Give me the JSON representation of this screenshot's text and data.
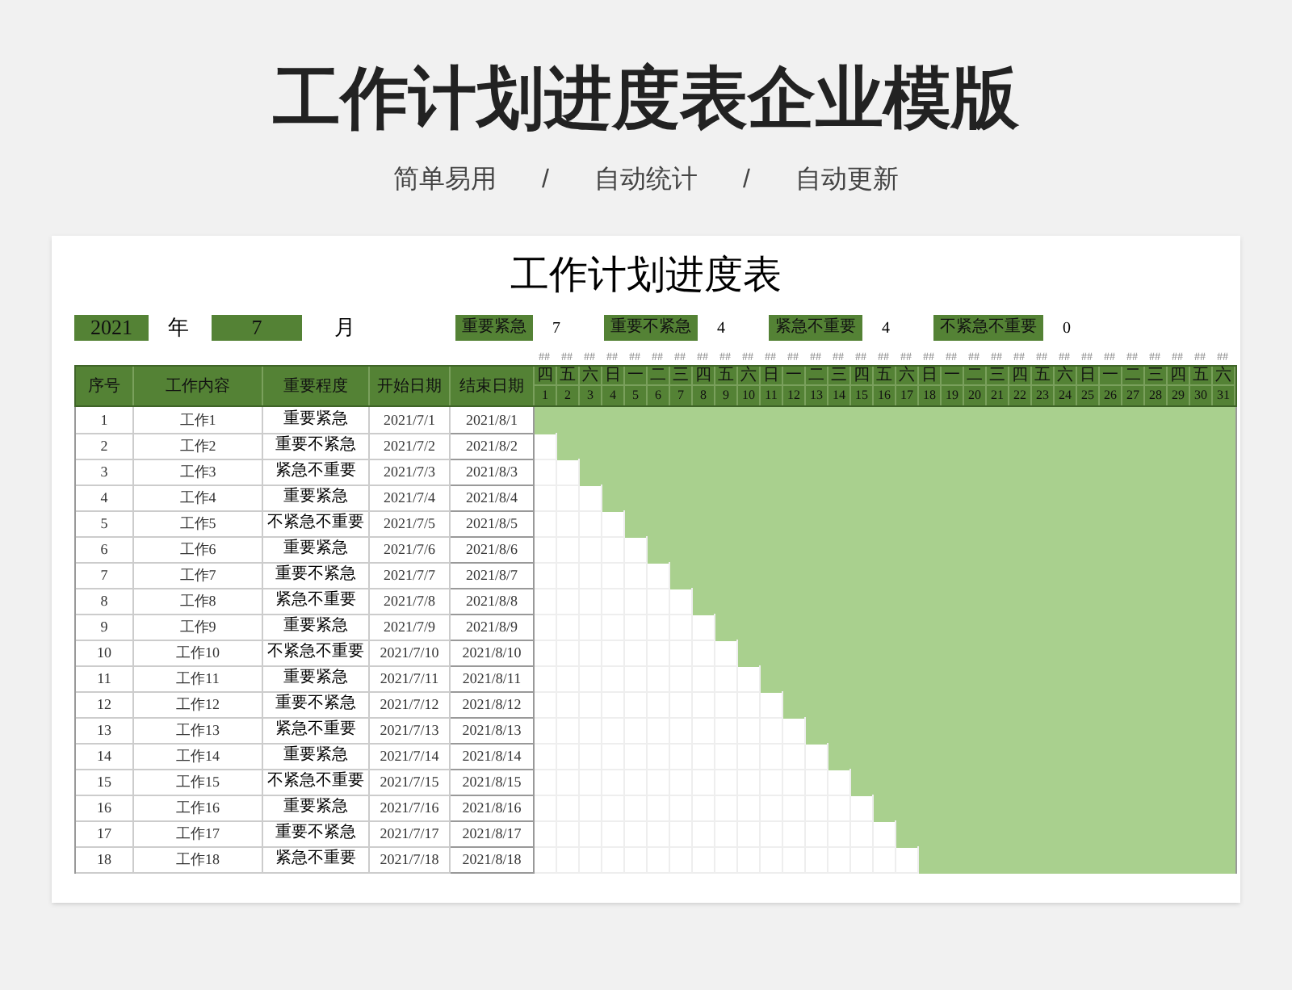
{
  "title": "工作计划进度表企业模版",
  "tags": [
    "简单易用",
    "自动统计",
    "自动更新"
  ],
  "separator": "/",
  "sheet": {
    "title": "工作计划进度表",
    "year": "2021",
    "year_label": "年",
    "month": "7",
    "month_label": "月",
    "legend": [
      {
        "label": "重要紧急",
        "count": "7"
      },
      {
        "label": "重要不紧急",
        "count": "4"
      },
      {
        "label": "紧急不重要",
        "count": "4"
      },
      {
        "label": "不紧急不重要",
        "count": "0"
      }
    ],
    "columns": [
      "序号",
      "工作内容",
      "重要程度",
      "开始日期",
      "结束日期"
    ],
    "days": [
      {
        "weekday": "四",
        "day": "1",
        "mark": "##"
      },
      {
        "weekday": "五",
        "day": "2",
        "mark": "##"
      },
      {
        "weekday": "六",
        "day": "3",
        "mark": "##"
      },
      {
        "weekday": "日",
        "day": "4",
        "mark": "##"
      },
      {
        "weekday": "一",
        "day": "5",
        "mark": "##"
      },
      {
        "weekday": "二",
        "day": "6",
        "mark": "##"
      },
      {
        "weekday": "三",
        "day": "7",
        "mark": "##"
      },
      {
        "weekday": "四",
        "day": "8",
        "mark": "##"
      },
      {
        "weekday": "五",
        "day": "9",
        "mark": "##"
      },
      {
        "weekday": "六",
        "day": "10",
        "mark": "##"
      },
      {
        "weekday": "日",
        "day": "11",
        "mark": "##"
      },
      {
        "weekday": "一",
        "day": "12",
        "mark": "##"
      },
      {
        "weekday": "二",
        "day": "13",
        "mark": "##"
      },
      {
        "weekday": "三",
        "day": "14",
        "mark": "##"
      },
      {
        "weekday": "四",
        "day": "15",
        "mark": "##"
      },
      {
        "weekday": "五",
        "day": "16",
        "mark": "##"
      },
      {
        "weekday": "六",
        "day": "17",
        "mark": "##"
      },
      {
        "weekday": "日",
        "day": "18",
        "mark": "##"
      },
      {
        "weekday": "一",
        "day": "19",
        "mark": "##"
      },
      {
        "weekday": "二",
        "day": "20",
        "mark": "##"
      },
      {
        "weekday": "三",
        "day": "21",
        "mark": "##"
      },
      {
        "weekday": "四",
        "day": "22",
        "mark": "##"
      },
      {
        "weekday": "五",
        "day": "23",
        "mark": "##"
      },
      {
        "weekday": "六",
        "day": "24",
        "mark": "##"
      },
      {
        "weekday": "日",
        "day": "25",
        "mark": "##"
      },
      {
        "weekday": "一",
        "day": "26",
        "mark": "##"
      },
      {
        "weekday": "二",
        "day": "27",
        "mark": "##"
      },
      {
        "weekday": "三",
        "day": "28",
        "mark": "##"
      },
      {
        "weekday": "四",
        "day": "29",
        "mark": "##"
      },
      {
        "weekday": "五",
        "day": "30",
        "mark": "##"
      },
      {
        "weekday": "六",
        "day": "31",
        "mark": "##"
      }
    ],
    "rows": [
      {
        "no": "1",
        "task": "工作1",
        "priority": "重要紧急",
        "start": "2021/7/1",
        "end": "2021/8/1"
      },
      {
        "no": "2",
        "task": "工作2",
        "priority": "重要不紧急",
        "start": "2021/7/2",
        "end": "2021/8/2"
      },
      {
        "no": "3",
        "task": "工作3",
        "priority": "紧急不重要",
        "start": "2021/7/3",
        "end": "2021/8/3"
      },
      {
        "no": "4",
        "task": "工作4",
        "priority": "重要紧急",
        "start": "2021/7/4",
        "end": "2021/8/4"
      },
      {
        "no": "5",
        "task": "工作5",
        "priority": "不紧急不重要",
        "start": "2021/7/5",
        "end": "2021/8/5"
      },
      {
        "no": "6",
        "task": "工作6",
        "priority": "重要紧急",
        "start": "2021/7/6",
        "end": "2021/8/6"
      },
      {
        "no": "7",
        "task": "工作7",
        "priority": "重要不紧急",
        "start": "2021/7/7",
        "end": "2021/8/7"
      },
      {
        "no": "8",
        "task": "工作8",
        "priority": "紧急不重要",
        "start": "2021/7/8",
        "end": "2021/8/8"
      },
      {
        "no": "9",
        "task": "工作9",
        "priority": "重要紧急",
        "start": "2021/7/9",
        "end": "2021/8/9"
      },
      {
        "no": "10",
        "task": "工作10",
        "priority": "不紧急不重要",
        "start": "2021/7/10",
        "end": "2021/8/10"
      },
      {
        "no": "11",
        "task": "工作11",
        "priority": "重要紧急",
        "start": "2021/7/11",
        "end": "2021/8/11"
      },
      {
        "no": "12",
        "task": "工作12",
        "priority": "重要不紧急",
        "start": "2021/7/12",
        "end": "2021/8/12"
      },
      {
        "no": "13",
        "task": "工作13",
        "priority": "紧急不重要",
        "start": "2021/7/13",
        "end": "2021/8/13"
      },
      {
        "no": "14",
        "task": "工作14",
        "priority": "重要紧急",
        "start": "2021/7/14",
        "end": "2021/8/14"
      },
      {
        "no": "15",
        "task": "工作15",
        "priority": "不紧急不重要",
        "start": "2021/7/15",
        "end": "2021/8/15"
      },
      {
        "no": "16",
        "task": "工作16",
        "priority": "重要紧急",
        "start": "2021/7/16",
        "end": "2021/8/16"
      },
      {
        "no": "17",
        "task": "工作17",
        "priority": "重要不紧急",
        "start": "2021/7/17",
        "end": "2021/8/17"
      },
      {
        "no": "18",
        "task": "工作18",
        "priority": "紧急不重要",
        "start": "2021/7/18",
        "end": "2021/8/18"
      }
    ]
  }
}
